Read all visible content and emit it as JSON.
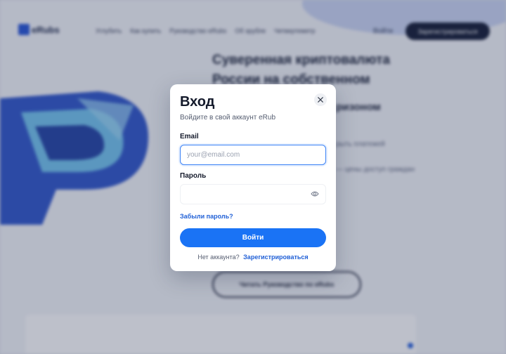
{
  "background": {
    "logo_text": "eRubs",
    "nav_links": [
      "Углубить",
      "Как купить",
      "Руководство eRubs",
      "Об эрубле",
      "Четвертеметр"
    ],
    "login": "Войти",
    "register": "Зарегистрироваться",
    "hero_title": "Суверенная криптовалюта России на собственном",
    "hero_subtitle": "ризоном",
    "hero_line1": "рыть платежей",
    "hero_line2": "— цены доступ граждан",
    "guide_button": "Читать Руководство по eRubs"
  },
  "modal": {
    "title": "Вход",
    "subtitle": "Войдите в свой аккаунт eRub",
    "close_icon": "close-icon",
    "email_label": "Email",
    "email_placeholder": "your@email.com",
    "email_value": "",
    "password_label": "Пароль",
    "password_value": "",
    "password_toggle_icon": "eye-icon",
    "forgot_password": "Забыли пароль?",
    "submit": "Войти",
    "no_account": "Нет аккаунта?",
    "signup_link": "Зарегистрироваться"
  },
  "colors": {
    "accent": "#1a73f5",
    "link": "#1f5fd6",
    "focus_border": "#3b82f6",
    "title": "#141a2b"
  }
}
